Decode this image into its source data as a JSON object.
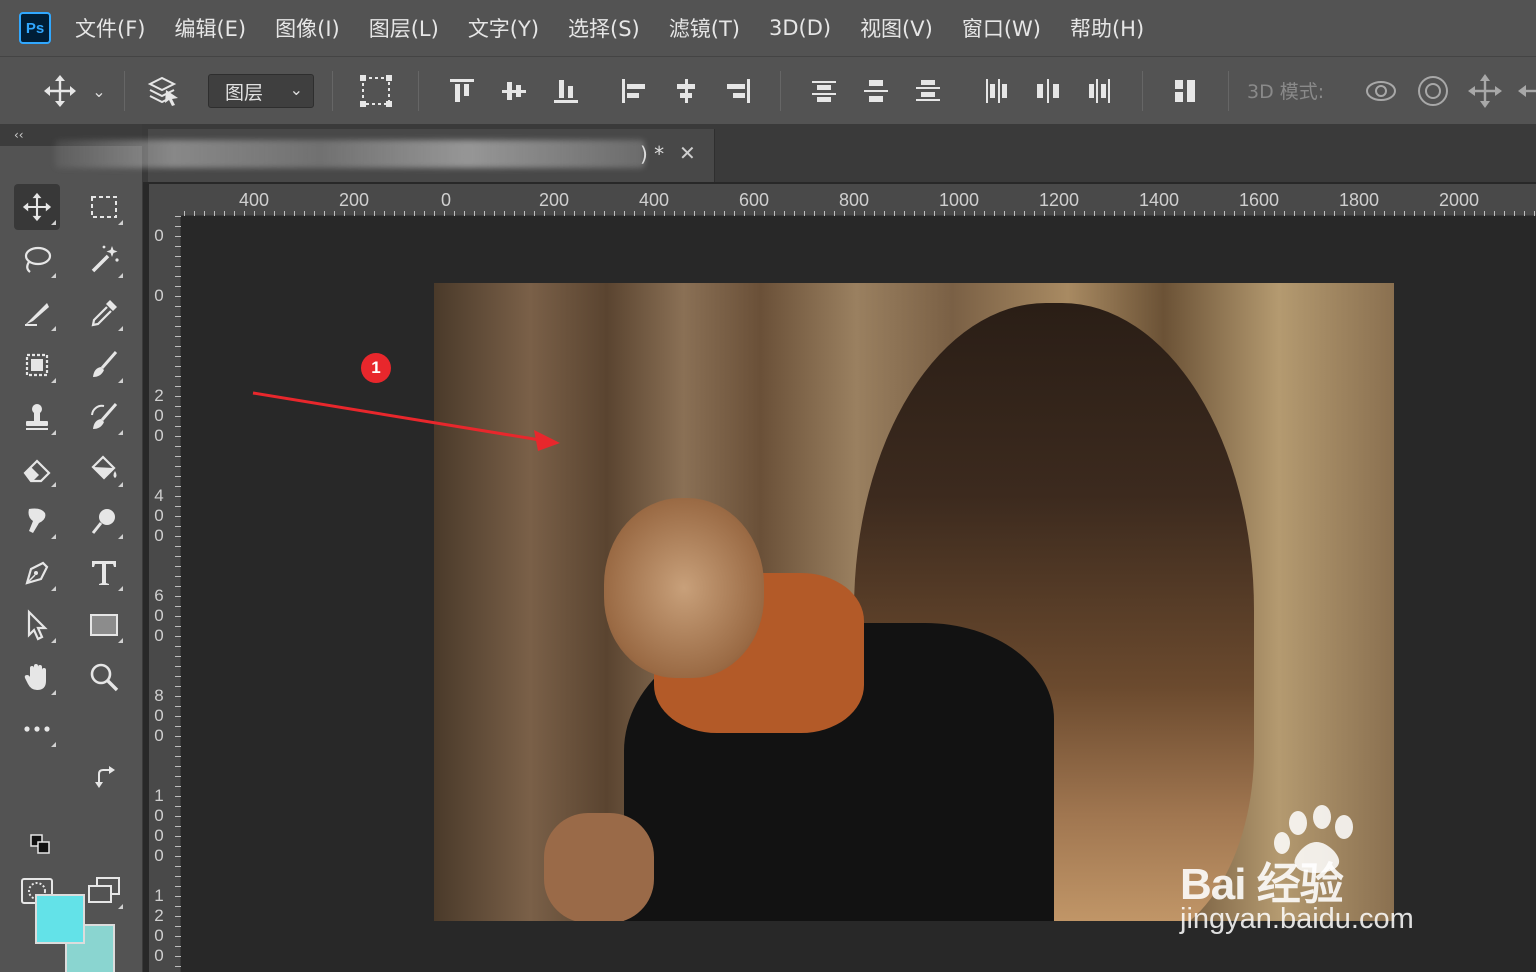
{
  "app": {
    "logo_text": "Ps"
  },
  "menu": [
    "文件(F)",
    "编辑(E)",
    "图像(I)",
    "图层(L)",
    "文字(Y)",
    "选择(S)",
    "滤镜(T)",
    "3D(D)",
    "视图(V)",
    "窗口(W)",
    "帮助(H)"
  ],
  "options": {
    "auto_select_target": "图层",
    "mode_label": "3D 模式:"
  },
  "toolbar": {
    "collapse_label": "‹‹"
  },
  "document": {
    "tab_suffix": ") *",
    "close_glyph": "✕"
  },
  "ruler": {
    "top_labels": [
      "400",
      "200",
      "0",
      "200",
      "400",
      "600",
      "800",
      "1000",
      "1200",
      "1400",
      "1600",
      "1800",
      "2000"
    ],
    "left_labels": [
      "0",
      "0",
      "200",
      "400",
      "600",
      "800",
      "1000",
      "1200"
    ]
  },
  "colors": {
    "foreground": "#63e2e8",
    "background": "#8ad5d0",
    "annotation": "#e8272c"
  },
  "annotation": {
    "badge": "1"
  },
  "watermark": {
    "brand": "Bai  经验",
    "url": "jingyan.baidu.com"
  }
}
